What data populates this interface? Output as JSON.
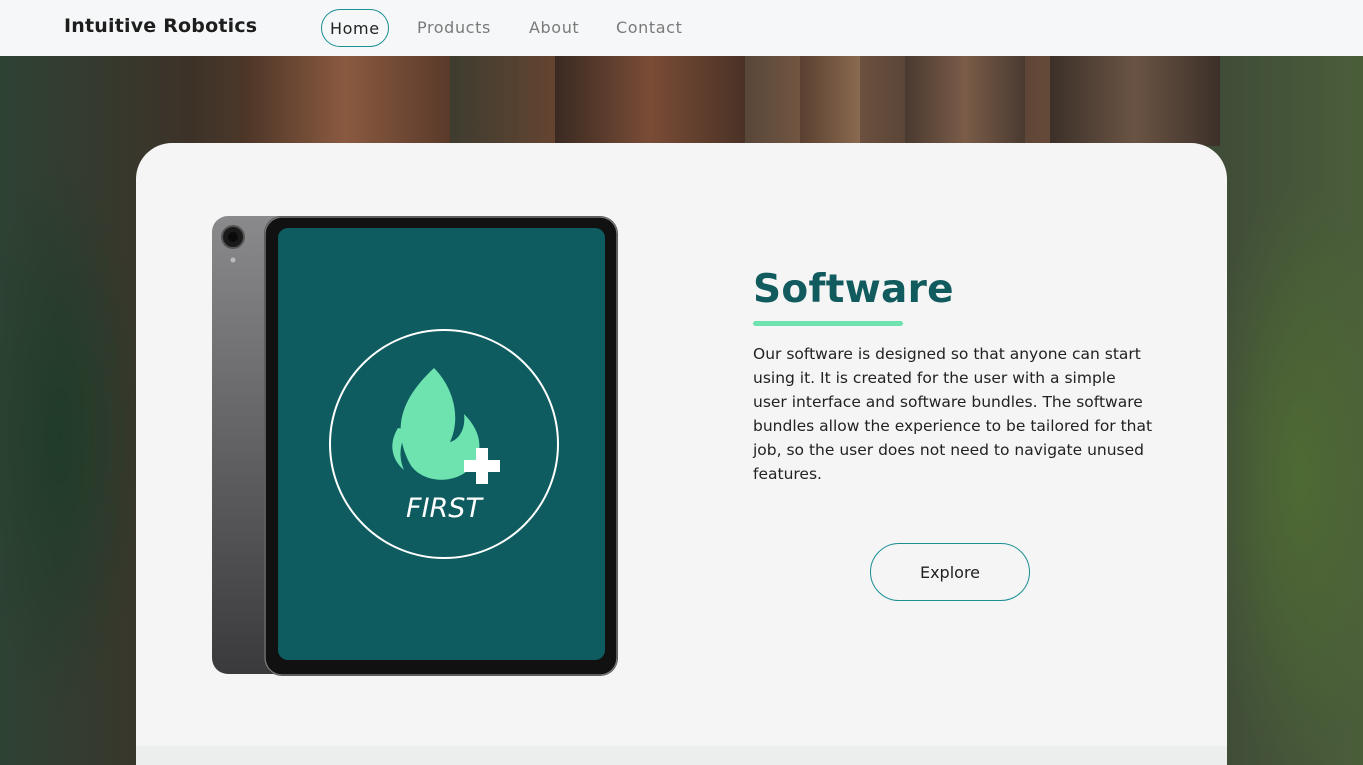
{
  "header": {
    "brand": "Intuitive Robotics",
    "nav": [
      {
        "label": "Home"
      },
      {
        "label": "Products"
      },
      {
        "label": "About"
      },
      {
        "label": "Contact"
      }
    ]
  },
  "section": {
    "title": "Software",
    "description": "Our software is designed so that anyone can start using it. It is created for the user with a simple user interface and software bundles. The software bundles allow the experience to be tailored for that job, so the user does not need to navigate unused features.",
    "button_label": "Explore"
  },
  "tablet_screen": {
    "logo_text": "FIRST"
  },
  "colors": {
    "accent": "#1a8f94",
    "title": "#115a5e",
    "underline": "#6ee3b0",
    "screen": "#0e5c60"
  },
  "icons": [
    "flame-plus-logo-icon",
    "camera-icon"
  ]
}
